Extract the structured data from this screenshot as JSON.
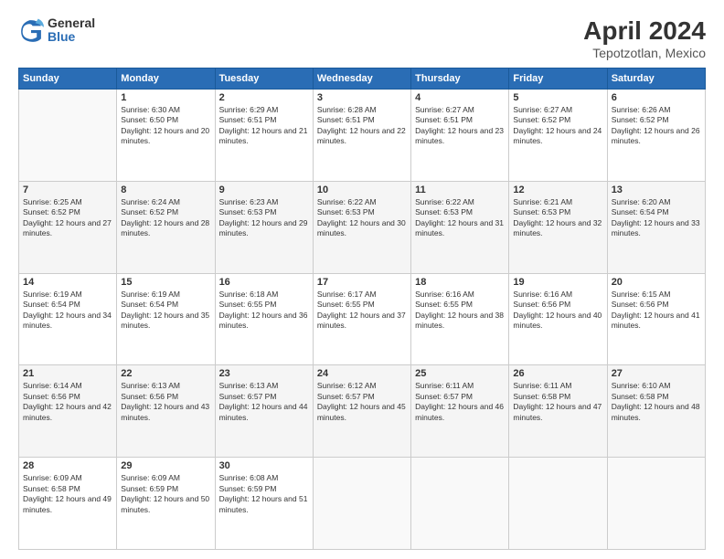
{
  "logo": {
    "general": "General",
    "blue": "Blue"
  },
  "header": {
    "title": "April 2024",
    "subtitle": "Tepotzotlan, Mexico"
  },
  "days_of_week": [
    "Sunday",
    "Monday",
    "Tuesday",
    "Wednesday",
    "Thursday",
    "Friday",
    "Saturday"
  ],
  "weeks": [
    [
      {
        "num": "",
        "sunrise": "",
        "sunset": "",
        "daylight": "",
        "empty": true
      },
      {
        "num": "1",
        "sunrise": "Sunrise: 6:30 AM",
        "sunset": "Sunset: 6:50 PM",
        "daylight": "Daylight: 12 hours and 20 minutes."
      },
      {
        "num": "2",
        "sunrise": "Sunrise: 6:29 AM",
        "sunset": "Sunset: 6:51 PM",
        "daylight": "Daylight: 12 hours and 21 minutes."
      },
      {
        "num": "3",
        "sunrise": "Sunrise: 6:28 AM",
        "sunset": "Sunset: 6:51 PM",
        "daylight": "Daylight: 12 hours and 22 minutes."
      },
      {
        "num": "4",
        "sunrise": "Sunrise: 6:27 AM",
        "sunset": "Sunset: 6:51 PM",
        "daylight": "Daylight: 12 hours and 23 minutes."
      },
      {
        "num": "5",
        "sunrise": "Sunrise: 6:27 AM",
        "sunset": "Sunset: 6:52 PM",
        "daylight": "Daylight: 12 hours and 24 minutes."
      },
      {
        "num": "6",
        "sunrise": "Sunrise: 6:26 AM",
        "sunset": "Sunset: 6:52 PM",
        "daylight": "Daylight: 12 hours and 26 minutes."
      }
    ],
    [
      {
        "num": "7",
        "sunrise": "Sunrise: 6:25 AM",
        "sunset": "Sunset: 6:52 PM",
        "daylight": "Daylight: 12 hours and 27 minutes."
      },
      {
        "num": "8",
        "sunrise": "Sunrise: 6:24 AM",
        "sunset": "Sunset: 6:52 PM",
        "daylight": "Daylight: 12 hours and 28 minutes."
      },
      {
        "num": "9",
        "sunrise": "Sunrise: 6:23 AM",
        "sunset": "Sunset: 6:53 PM",
        "daylight": "Daylight: 12 hours and 29 minutes."
      },
      {
        "num": "10",
        "sunrise": "Sunrise: 6:22 AM",
        "sunset": "Sunset: 6:53 PM",
        "daylight": "Daylight: 12 hours and 30 minutes."
      },
      {
        "num": "11",
        "sunrise": "Sunrise: 6:22 AM",
        "sunset": "Sunset: 6:53 PM",
        "daylight": "Daylight: 12 hours and 31 minutes."
      },
      {
        "num": "12",
        "sunrise": "Sunrise: 6:21 AM",
        "sunset": "Sunset: 6:53 PM",
        "daylight": "Daylight: 12 hours and 32 minutes."
      },
      {
        "num": "13",
        "sunrise": "Sunrise: 6:20 AM",
        "sunset": "Sunset: 6:54 PM",
        "daylight": "Daylight: 12 hours and 33 minutes."
      }
    ],
    [
      {
        "num": "14",
        "sunrise": "Sunrise: 6:19 AM",
        "sunset": "Sunset: 6:54 PM",
        "daylight": "Daylight: 12 hours and 34 minutes."
      },
      {
        "num": "15",
        "sunrise": "Sunrise: 6:19 AM",
        "sunset": "Sunset: 6:54 PM",
        "daylight": "Daylight: 12 hours and 35 minutes."
      },
      {
        "num": "16",
        "sunrise": "Sunrise: 6:18 AM",
        "sunset": "Sunset: 6:55 PM",
        "daylight": "Daylight: 12 hours and 36 minutes."
      },
      {
        "num": "17",
        "sunrise": "Sunrise: 6:17 AM",
        "sunset": "Sunset: 6:55 PM",
        "daylight": "Daylight: 12 hours and 37 minutes."
      },
      {
        "num": "18",
        "sunrise": "Sunrise: 6:16 AM",
        "sunset": "Sunset: 6:55 PM",
        "daylight": "Daylight: 12 hours and 38 minutes."
      },
      {
        "num": "19",
        "sunrise": "Sunrise: 6:16 AM",
        "sunset": "Sunset: 6:56 PM",
        "daylight": "Daylight: 12 hours and 40 minutes."
      },
      {
        "num": "20",
        "sunrise": "Sunrise: 6:15 AM",
        "sunset": "Sunset: 6:56 PM",
        "daylight": "Daylight: 12 hours and 41 minutes."
      }
    ],
    [
      {
        "num": "21",
        "sunrise": "Sunrise: 6:14 AM",
        "sunset": "Sunset: 6:56 PM",
        "daylight": "Daylight: 12 hours and 42 minutes."
      },
      {
        "num": "22",
        "sunrise": "Sunrise: 6:13 AM",
        "sunset": "Sunset: 6:56 PM",
        "daylight": "Daylight: 12 hours and 43 minutes."
      },
      {
        "num": "23",
        "sunrise": "Sunrise: 6:13 AM",
        "sunset": "Sunset: 6:57 PM",
        "daylight": "Daylight: 12 hours and 44 minutes."
      },
      {
        "num": "24",
        "sunrise": "Sunrise: 6:12 AM",
        "sunset": "Sunset: 6:57 PM",
        "daylight": "Daylight: 12 hours and 45 minutes."
      },
      {
        "num": "25",
        "sunrise": "Sunrise: 6:11 AM",
        "sunset": "Sunset: 6:57 PM",
        "daylight": "Daylight: 12 hours and 46 minutes."
      },
      {
        "num": "26",
        "sunrise": "Sunrise: 6:11 AM",
        "sunset": "Sunset: 6:58 PM",
        "daylight": "Daylight: 12 hours and 47 minutes."
      },
      {
        "num": "27",
        "sunrise": "Sunrise: 6:10 AM",
        "sunset": "Sunset: 6:58 PM",
        "daylight": "Daylight: 12 hours and 48 minutes."
      }
    ],
    [
      {
        "num": "28",
        "sunrise": "Sunrise: 6:09 AM",
        "sunset": "Sunset: 6:58 PM",
        "daylight": "Daylight: 12 hours and 49 minutes."
      },
      {
        "num": "29",
        "sunrise": "Sunrise: 6:09 AM",
        "sunset": "Sunset: 6:59 PM",
        "daylight": "Daylight: 12 hours and 50 minutes."
      },
      {
        "num": "30",
        "sunrise": "Sunrise: 6:08 AM",
        "sunset": "Sunset: 6:59 PM",
        "daylight": "Daylight: 12 hours and 51 minutes."
      },
      {
        "num": "",
        "sunrise": "",
        "sunset": "",
        "daylight": "",
        "empty": true
      },
      {
        "num": "",
        "sunrise": "",
        "sunset": "",
        "daylight": "",
        "empty": true
      },
      {
        "num": "",
        "sunrise": "",
        "sunset": "",
        "daylight": "",
        "empty": true
      },
      {
        "num": "",
        "sunrise": "",
        "sunset": "",
        "daylight": "",
        "empty": true
      }
    ]
  ]
}
